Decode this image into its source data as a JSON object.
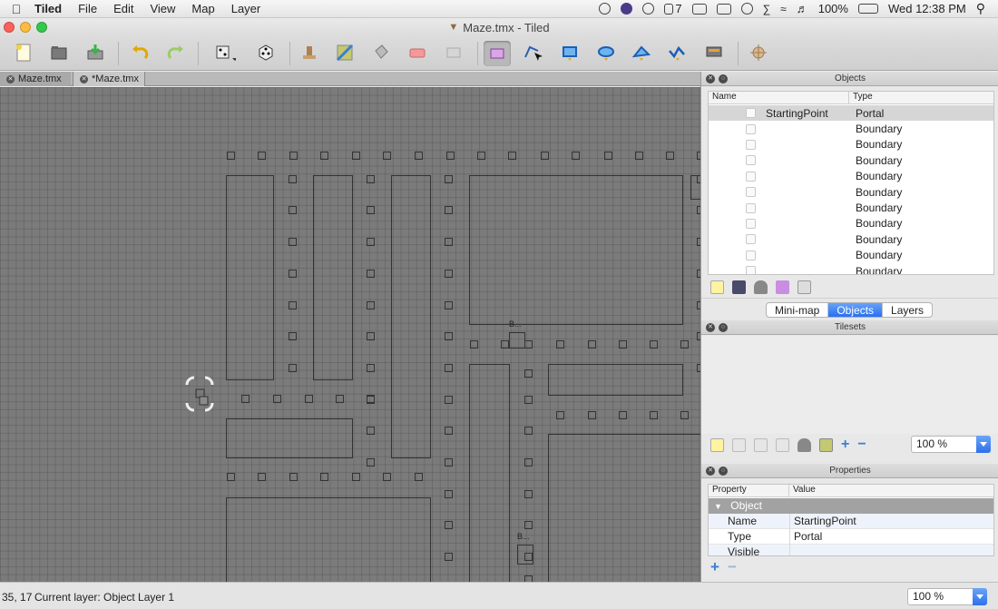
{
  "menubar": {
    "app_name": "Tiled",
    "items": [
      "File",
      "Edit",
      "View",
      "Map",
      "Layer"
    ],
    "notification_count": "7",
    "battery": "100%",
    "clock": "Wed 12:38 PM"
  },
  "window": {
    "title": "Maze.tmx - Tiled",
    "traffic_colors": [
      "#fc605b",
      "#fdbc40",
      "#34c84a"
    ]
  },
  "toolbar": {
    "buttons": [
      "new-map",
      "open-map",
      "save-map",
      "undo",
      "redo",
      "random-mode",
      "wang-mode",
      "stamp-brush",
      "terrain-brush",
      "bucket-fill",
      "eraser",
      "rectangular-select",
      "select-objects",
      "edit-polygons",
      "insert-rectangle",
      "insert-ellipse",
      "insert-polygon",
      "insert-polyline",
      "insert-tile",
      "offset-map"
    ],
    "active_tool": "select-objects"
  },
  "tabs": [
    {
      "label": "Maze.tmx",
      "active": false
    },
    {
      "label": "*Maze.tmx",
      "active": true
    }
  ],
  "canvas": {
    "object_labels": [
      "B...",
      "B..."
    ]
  },
  "objects_panel": {
    "title": "Objects",
    "columns": {
      "name": "Name",
      "type": "Type"
    },
    "rows": [
      {
        "name": "StartingPoint",
        "type": "Portal",
        "selected": true
      },
      {
        "name": "",
        "type": "Boundary"
      },
      {
        "name": "",
        "type": "Boundary"
      },
      {
        "name": "",
        "type": "Boundary"
      },
      {
        "name": "",
        "type": "Boundary"
      },
      {
        "name": "",
        "type": "Boundary"
      },
      {
        "name": "",
        "type": "Boundary"
      },
      {
        "name": "",
        "type": "Boundary"
      },
      {
        "name": "",
        "type": "Boundary"
      },
      {
        "name": "",
        "type": "Boundary"
      },
      {
        "name": "",
        "type": "Boundary"
      }
    ]
  },
  "dock_tabs": {
    "items": [
      "Mini-map",
      "Objects",
      "Layers"
    ],
    "active": "Objects"
  },
  "tilesets_panel": {
    "title": "Tilesets",
    "zoom": "100 %"
  },
  "properties_panel": {
    "title": "Properties",
    "columns": {
      "property": "Property",
      "value": "Value"
    },
    "group": "Object",
    "rows": [
      {
        "property": "Name",
        "value": "StartingPoint"
      },
      {
        "property": "Type",
        "value": "Portal"
      },
      {
        "property": "Visible",
        "value": ""
      }
    ]
  },
  "statusbar": {
    "coords": "35, 17",
    "layer_text": "Current layer: Object Layer 1",
    "zoom": "100 %"
  }
}
